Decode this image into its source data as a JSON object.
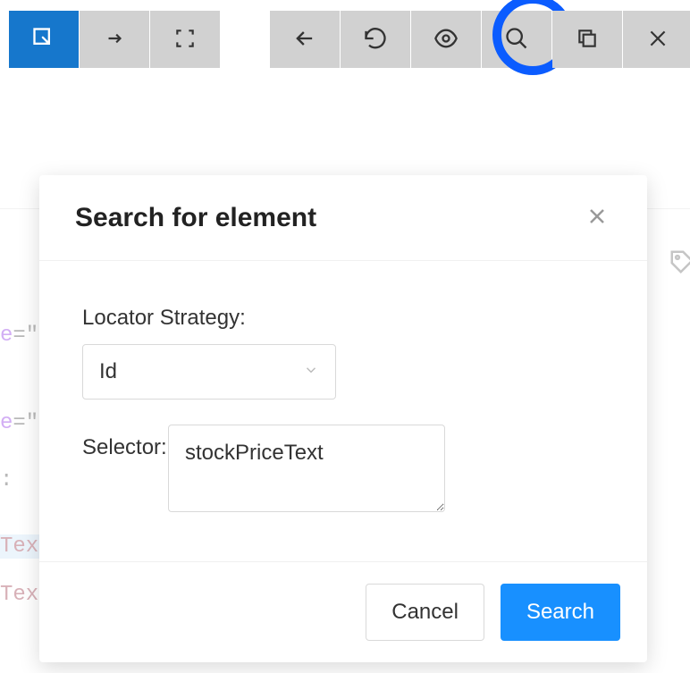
{
  "toolbar": {
    "select_element": "select-element",
    "arrow_right_small": "arrow",
    "fullscreen": "fullscreen",
    "back": "back",
    "refresh": "refresh",
    "eye": "show-hide",
    "search": "search",
    "copy": "copy",
    "close": "close"
  },
  "modal": {
    "title": "Search for element",
    "locator_label": "Locator Strategy:",
    "locator_value": "Id",
    "selector_label": "Selector:",
    "selector_value": "stockPriceText",
    "cancel_label": "Cancel",
    "search_label": "Search"
  },
  "background": {
    "attr_fragment_1": "e",
    "equals_quote": "=\"",
    "attr_fragment_2": "e",
    "element_colon": ":",
    "element_text_1": "Text",
    "element_text_2": "Text"
  }
}
